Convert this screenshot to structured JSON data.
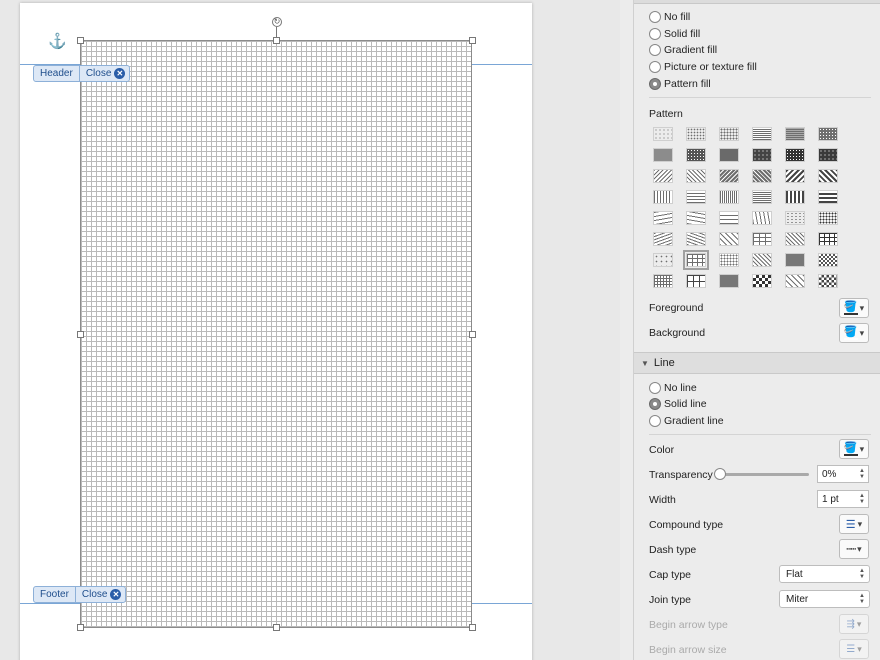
{
  "document": {
    "header_tab": {
      "label": "Header",
      "close_label": "Close"
    },
    "footer_tab": {
      "label": "Footer",
      "close_label": "Close"
    }
  },
  "fill": {
    "options": [
      {
        "label": "No fill",
        "selected": false
      },
      {
        "label": "Solid fill",
        "selected": false
      },
      {
        "label": "Gradient fill",
        "selected": false
      },
      {
        "label": "Picture or texture fill",
        "selected": false
      },
      {
        "label": "Pattern fill",
        "selected": true
      }
    ],
    "pattern_label": "Pattern",
    "foreground_label": "Foreground",
    "background_label": "Background",
    "selected_pattern_index": 37
  },
  "line": {
    "section_title": "Line",
    "options": [
      {
        "label": "No line",
        "selected": false
      },
      {
        "label": "Solid line",
        "selected": true
      },
      {
        "label": "Gradient line",
        "selected": false
      }
    ],
    "color_label": "Color",
    "transparency_label": "Transparency",
    "transparency_value": "0%",
    "width_label": "Width",
    "width_value": "1 pt",
    "compound_label": "Compound type",
    "dash_label": "Dash type",
    "cap_label": "Cap type",
    "cap_value": "Flat",
    "join_label": "Join type",
    "join_value": "Miter",
    "begin_arrow_type_label": "Begin arrow type",
    "begin_arrow_size_label": "Begin arrow size"
  },
  "colors": {
    "guide": "#7aa6d6",
    "tab_bg": "#dde8f6",
    "tab_text": "#1f4e8c"
  }
}
